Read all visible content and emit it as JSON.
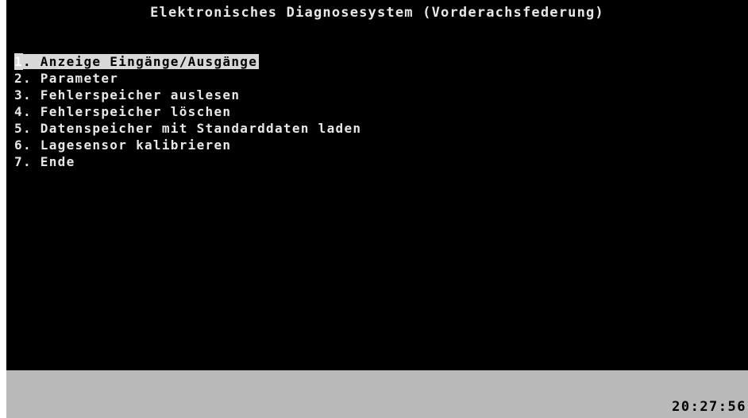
{
  "title": "Elektronisches Diagnosesystem (Vorderachsfederung)",
  "menu": {
    "selected_index": 0,
    "items": [
      {
        "number": "1",
        "label": ". Anzeige Eingänge/Ausgänge"
      },
      {
        "number": "2",
        "label": ". Parameter"
      },
      {
        "number": "3",
        "label": ". Fehlerspeicher auslesen"
      },
      {
        "number": "4",
        "label": ". Fehlerspeicher löschen"
      },
      {
        "number": "5",
        "label": ". Datenspeicher mit Standarddaten laden"
      },
      {
        "number": "6",
        "label": ". Lagesensor kalibrieren"
      },
      {
        "number": "7",
        "label": ". Ende"
      }
    ]
  },
  "status": {
    "time": "20:27:56"
  },
  "colors": {
    "screen_background": "#000000",
    "text": "#e8e8e8",
    "highlight": "#d8d8d8",
    "status_bar": "#b9b9b9"
  }
}
